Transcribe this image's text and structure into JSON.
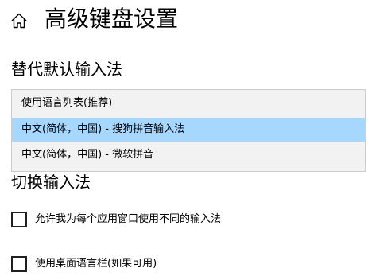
{
  "header": {
    "title": "高级键盘设置",
    "home_icon": "home-icon"
  },
  "default_input": {
    "heading": "替代默认输入法",
    "options": [
      {
        "label": "使用语言列表(推荐)",
        "selected": false
      },
      {
        "label": "中文(简体，中国) - 搜狗拼音输入法",
        "selected": true
      },
      {
        "label": "中文(简体，中国) - 微软拼音",
        "selected": false
      }
    ],
    "highlight_color": "#a6d8ff"
  },
  "switch_input": {
    "heading": "切换输入法",
    "per_app_window": {
      "label": "允许我为每个应用窗口使用不同的输入法",
      "checked": false
    },
    "desktop_language_bar": {
      "label": "使用桌面语言栏(如果可用)",
      "checked": false
    }
  }
}
